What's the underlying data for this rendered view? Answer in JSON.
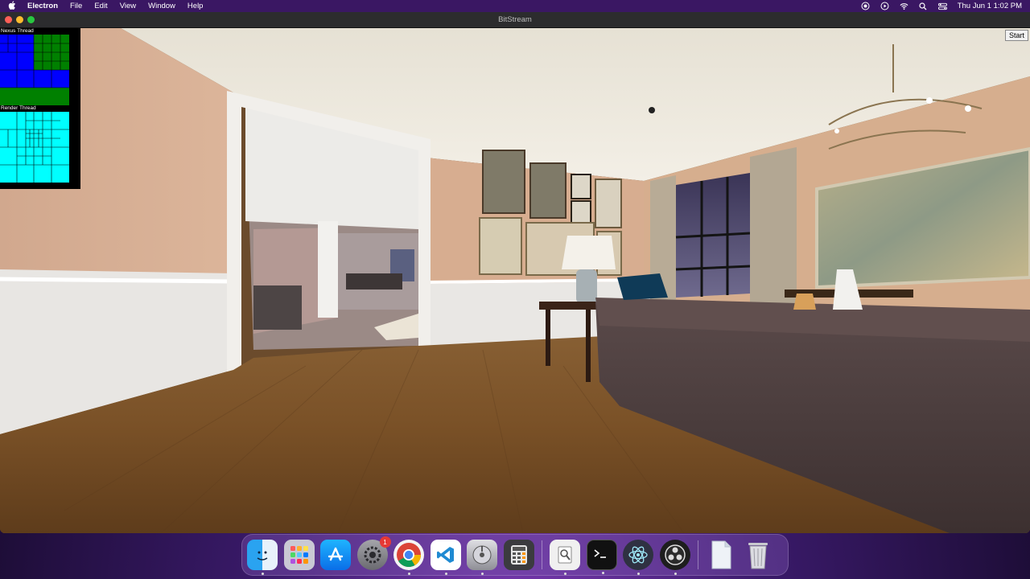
{
  "menubar": {
    "apple": "",
    "app_name": "Electron",
    "items": [
      "File",
      "Edit",
      "View",
      "Window",
      "Help"
    ],
    "clock": "Thu Jun 1  1:02 PM",
    "status_icons": [
      "screen-record-icon",
      "play-circle-icon",
      "wifi-icon",
      "search-icon",
      "control-center-icon"
    ]
  },
  "window": {
    "title": "BitStream",
    "traffic_lights": {
      "close": "#ff5f57",
      "minimize": "#febc2e",
      "zoom": "#28c840"
    },
    "start_button": "Start"
  },
  "debug_panel": {
    "nexus_label": "Nexus Thread",
    "render_label": "Render Thread",
    "colors": {
      "blue": "#0000ff",
      "green": "#008000",
      "cyan": "#00ffff"
    }
  },
  "dock": {
    "apps": [
      {
        "name": "finder-icon",
        "badge": "",
        "running": true
      },
      {
        "name": "launchpad-icon",
        "badge": "",
        "running": false
      },
      {
        "name": "app-store-icon",
        "badge": "",
        "running": false
      },
      {
        "name": "system-settings-icon",
        "badge": "1",
        "running": false
      },
      {
        "name": "chrome-icon",
        "badge": "",
        "running": true
      },
      {
        "name": "vscode-icon",
        "badge": "",
        "running": true
      },
      {
        "name": "disk-utility-icon",
        "badge": "",
        "running": true
      },
      {
        "name": "calculator-icon",
        "badge": "",
        "running": false
      },
      {
        "name": "preview-icon",
        "badge": "",
        "running": true
      },
      {
        "name": "terminal-icon",
        "badge": "",
        "running": true
      },
      {
        "name": "electron-icon",
        "badge": "",
        "running": true
      },
      {
        "name": "obs-icon",
        "badge": "",
        "running": true
      },
      {
        "name": "documents-stack-icon",
        "badge": "",
        "running": false
      },
      {
        "name": "trash-icon",
        "badge": "",
        "running": false
      }
    ]
  }
}
